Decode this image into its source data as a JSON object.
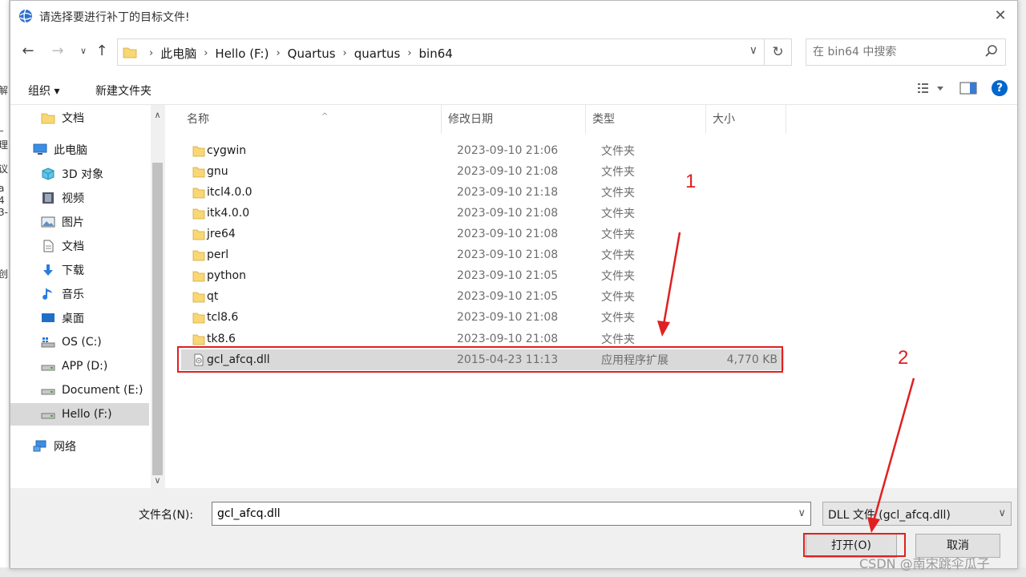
{
  "dialog": {
    "title": "请选择要进行补丁的目标文件!",
    "breadcrumb": [
      "此电脑",
      "Hello (F:)",
      "Quartus",
      "quartus",
      "bin64"
    ],
    "search_placeholder": "在 bin64 中搜索",
    "toolbar": {
      "organize": "组织 ▾",
      "new_folder": "新建文件夹"
    },
    "nav": [
      {
        "label": "文档",
        "icon": "folder-icon",
        "indent": 1
      },
      {
        "label": "此电脑",
        "icon": "computer-icon",
        "indent": 0
      },
      {
        "label": "3D 对象",
        "icon": "3d-objects-icon",
        "indent": 1
      },
      {
        "label": "视频",
        "icon": "video-icon",
        "indent": 1
      },
      {
        "label": "图片",
        "icon": "pictures-icon",
        "indent": 1
      },
      {
        "label": "文档",
        "icon": "documents-icon",
        "indent": 1
      },
      {
        "label": "下载",
        "icon": "download-icon",
        "indent": 1
      },
      {
        "label": "音乐",
        "icon": "music-icon",
        "indent": 1
      },
      {
        "label": "桌面",
        "icon": "desktop-icon",
        "indent": 1
      },
      {
        "label": "OS (C:)",
        "icon": "drive-icon",
        "indent": 1
      },
      {
        "label": "APP (D:)",
        "icon": "drive-icon",
        "indent": 1
      },
      {
        "label": "Document (E:)",
        "icon": "drive-icon",
        "indent": 1
      },
      {
        "label": "Hello (F:)",
        "icon": "drive-icon",
        "indent": 1,
        "selected": true
      },
      {
        "label": "网络",
        "icon": "network-icon",
        "indent": 0
      }
    ],
    "columns": [
      "名称",
      "修改日期",
      "类型",
      "大小"
    ],
    "files": [
      {
        "name": "cygwin",
        "date": "2023-09-10 21:06",
        "type": "文件夹",
        "size": ""
      },
      {
        "name": "gnu",
        "date": "2023-09-10 21:08",
        "type": "文件夹",
        "size": ""
      },
      {
        "name": "itcl4.0.0",
        "date": "2023-09-10 21:18",
        "type": "文件夹",
        "size": ""
      },
      {
        "name": "itk4.0.0",
        "date": "2023-09-10 21:08",
        "type": "文件夹",
        "size": ""
      },
      {
        "name": "jre64",
        "date": "2023-09-10 21:08",
        "type": "文件夹",
        "size": ""
      },
      {
        "name": "perl",
        "date": "2023-09-10 21:08",
        "type": "文件夹",
        "size": ""
      },
      {
        "name": "python",
        "date": "2023-09-10 21:05",
        "type": "文件夹",
        "size": ""
      },
      {
        "name": "qt",
        "date": "2023-09-10 21:05",
        "type": "文件夹",
        "size": ""
      },
      {
        "name": "tcl8.6",
        "date": "2023-09-10 21:08",
        "type": "文件夹",
        "size": ""
      },
      {
        "name": "tk8.6",
        "date": "2023-09-10 21:08",
        "type": "文件夹",
        "size": ""
      },
      {
        "name": "gcl_afcq.dll",
        "date": "2015-04-23 11:13",
        "type": "应用程序扩展",
        "size": "4,770 KB",
        "selected": true
      }
    ],
    "filename_label": "文件名(N):",
    "filename_value": "gcl_afcq.dll",
    "filetype": "DLL 文件 (gcl_afcq.dll)",
    "open_button": "打开(O)",
    "cancel_button": "取消"
  },
  "annotations": {
    "step1": "1",
    "step2": "2"
  },
  "behind_window": {
    "fragments": [
      "解",
      "_",
      "理",
      "议",
      "a",
      "4",
      "3-",
      "创"
    ]
  },
  "watermark": "CSDN @南宋跳伞瓜子",
  "colors": {
    "accent": "#0066cc",
    "annotation": "#e02020",
    "folder": "#f8d775"
  }
}
